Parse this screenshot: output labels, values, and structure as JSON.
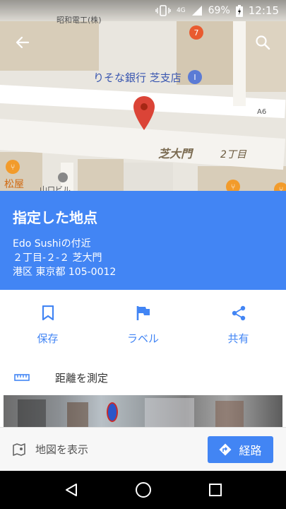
{
  "status_bar": {
    "network": "4G",
    "battery": "69%",
    "time": "12:15"
  },
  "map": {
    "labels": {
      "company": "昭和電工(株)",
      "bank": "りそな銀行 芝支店",
      "route_shield": "A6",
      "area": "芝大門",
      "block": "2丁目",
      "restaurant": "松屋",
      "building": "山口ビル"
    }
  },
  "place": {
    "title": "指定した地点",
    "nearby": "Edo Sushiの付近",
    "address_line1": "２丁目-２-２ 芝大門",
    "address_line2": "港区 東京都 105-0012"
  },
  "actions": {
    "save": "保存",
    "label": "ラベル",
    "share": "共有"
  },
  "measure": {
    "label": "距離を測定"
  },
  "bottom": {
    "show_map": "地図を表示",
    "route": "経路"
  },
  "colors": {
    "accent": "#4285f4",
    "pin": "#db4437"
  }
}
